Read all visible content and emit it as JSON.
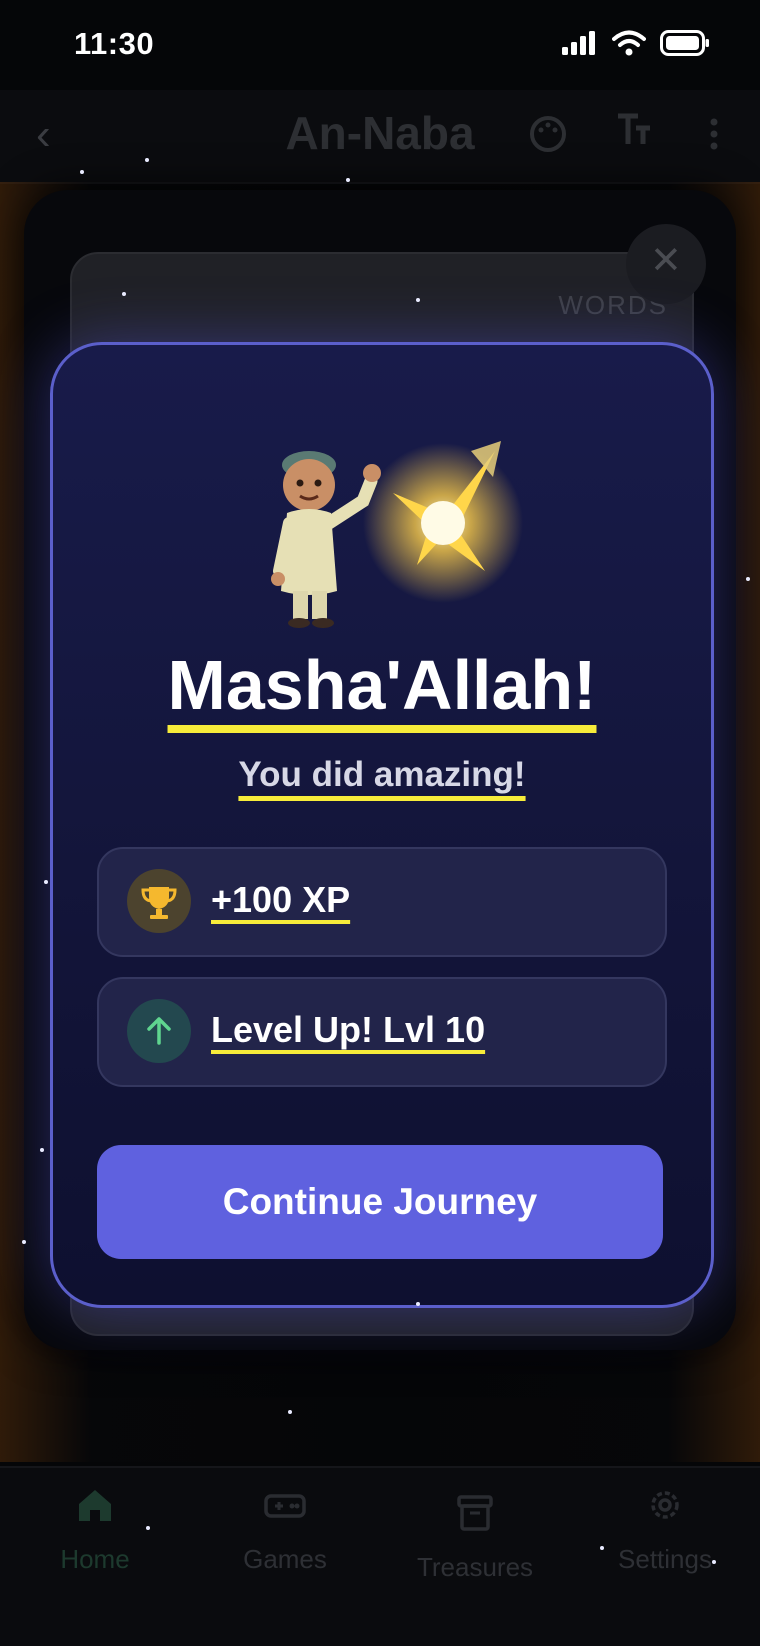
{
  "status_bar": {
    "time": "11:30"
  },
  "header": {
    "back_icon": "chevron-left-icon",
    "title": "An-Naba",
    "icons": [
      "palette-icon",
      "text-size-icon",
      "more-vertical-icon"
    ]
  },
  "background_card": {
    "label": "WORDS"
  },
  "modal": {
    "headline": "Masha'Allah!",
    "subline": "You did amazing!",
    "rewards": [
      {
        "icon": "trophy-icon",
        "text": "+100 XP"
      },
      {
        "icon": "arrow-up-icon",
        "text": "Level Up! Lvl 10"
      }
    ],
    "continue_label": "Continue Journey"
  },
  "tabbar": {
    "tabs": [
      {
        "icon": "home-icon",
        "label": "Home",
        "active": true
      },
      {
        "icon": "gamepad-icon",
        "label": "Games",
        "active": false
      },
      {
        "icon": "archive-box-icon",
        "label": "Treasures",
        "active": false
      },
      {
        "icon": "gear-icon",
        "label": "Settings",
        "active": false
      }
    ]
  },
  "colors": {
    "accent": "#5f61df",
    "highlight": "#f7ec3a",
    "modal_border": "#5b5fcb"
  }
}
